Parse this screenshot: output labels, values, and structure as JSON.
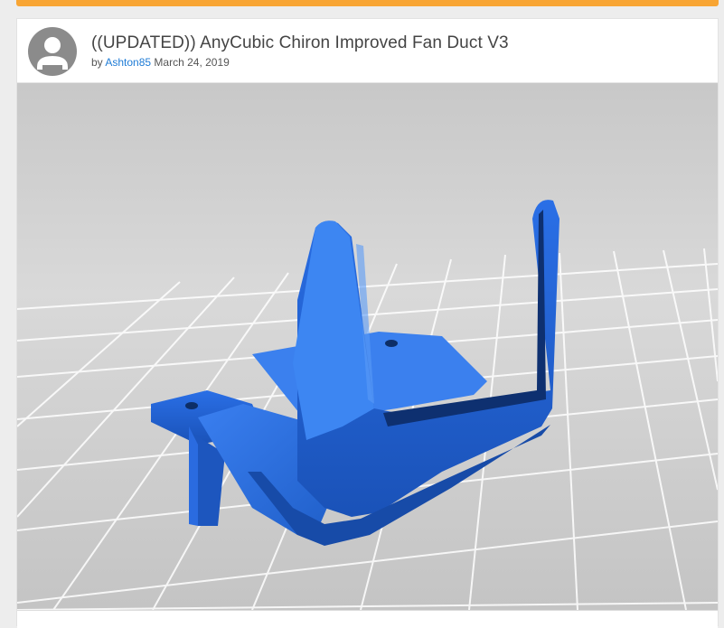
{
  "post": {
    "title": "((UPDATED)) AnyCubic Chiron Improved Fan Duct V3",
    "by_label": "by",
    "author": "Ashton85",
    "date": "March 24, 2019"
  },
  "icons": {
    "avatar": "default-user-avatar-icon"
  },
  "colors": {
    "accent_bar": "#f8a534",
    "author_link": "#1f7cd6",
    "model_blue": "#2f6fdc",
    "background_gray": "#d6d6d6"
  }
}
